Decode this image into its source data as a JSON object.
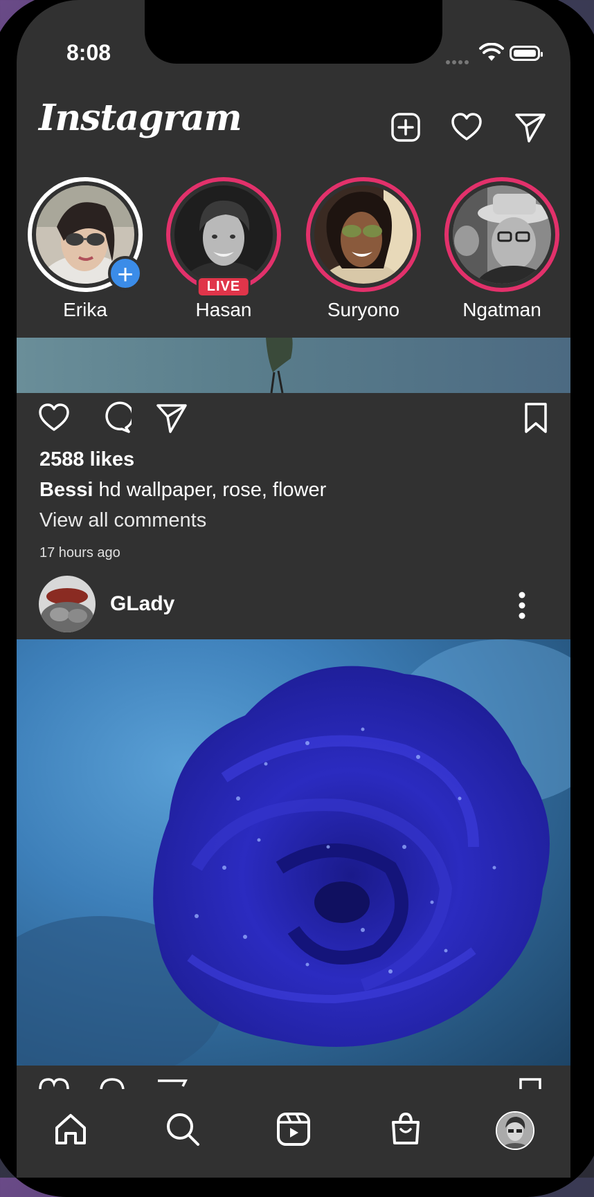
{
  "status_bar": {
    "time": "8:08"
  },
  "header": {
    "logo": "Instagram",
    "icons": [
      "new-post-icon",
      "heart-icon",
      "send-icon"
    ]
  },
  "stories": [
    {
      "name": "Erika",
      "badge": "+",
      "own": true
    },
    {
      "name": "Hasan",
      "badge": "LIVE",
      "own": false
    },
    {
      "name": "Suryono",
      "badge": "",
      "own": false
    },
    {
      "name": "Ngatman",
      "badge": "",
      "own": false
    }
  ],
  "post1": {
    "likes": "2588 likes",
    "caption_user": "Bessi",
    "caption_text": " hd wallpaper, rose, flower",
    "view_comments": "View all comments",
    "time_ago": "17 hours ago"
  },
  "post2": {
    "username": "GLady"
  },
  "bottom_nav": [
    "home-icon",
    "search-icon",
    "reels-icon",
    "shop-icon",
    "profile-avatar"
  ],
  "colors": {
    "background": "#313131",
    "story_ring": "#e2316b",
    "live_badge": "#e0354a",
    "add_badge": "#3b8ce8"
  }
}
